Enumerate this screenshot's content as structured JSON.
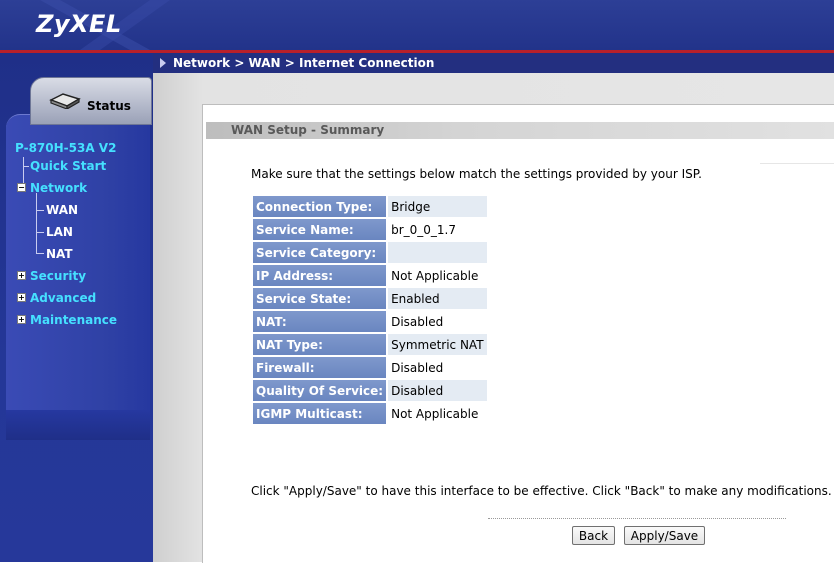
{
  "brand": {
    "logo": "ZyXEL"
  },
  "breadcrumb": "Network > WAN > Internet Connection",
  "status_tab": {
    "label": "Status",
    "icon": "router-icon"
  },
  "nav": {
    "model": "P-870H-53A V2",
    "quick_start": "Quick Start",
    "network": "Network",
    "network_children": [
      "WAN",
      "LAN",
      "NAT"
    ],
    "security": "Security",
    "advanced": "Advanced",
    "maintenance": "Maintenance"
  },
  "page": {
    "section_title": "WAN Setup - Summary",
    "intro": "Make sure that the settings below match the settings provided by your ISP.",
    "rows": [
      {
        "label": "Connection Type:",
        "value": "Bridge"
      },
      {
        "label": "Service Name:",
        "value": "br_0_0_1.7"
      },
      {
        "label": "Service Category:",
        "value": ""
      },
      {
        "label": "IP Address:",
        "value": "Not Applicable"
      },
      {
        "label": "Service State:",
        "value": "Enabled"
      },
      {
        "label": "NAT:",
        "value": "Disabled"
      },
      {
        "label": "NAT Type:",
        "value": "Symmetric NAT"
      },
      {
        "label": "Firewall:",
        "value": "Disabled"
      },
      {
        "label": "Quality Of Service:",
        "value": "Disabled"
      },
      {
        "label": "IGMP Multicast:",
        "value": "Not Applicable"
      }
    ],
    "footer": "Click \"Apply/Save\" to have this interface to be effective. Click \"Back\" to make any modifications.",
    "back_label": "Back",
    "apply_label": "Apply/Save"
  },
  "colors": {
    "header": "#22338a",
    "accent_line": "#b8202a",
    "nav_link": "#45e0ff",
    "table_label": "#7590c8"
  }
}
